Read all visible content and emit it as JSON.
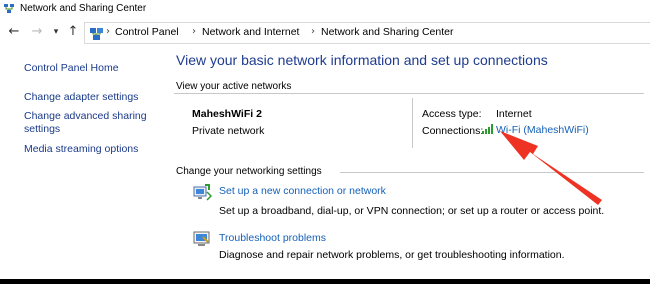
{
  "window": {
    "title": "Network and Sharing Center",
    "icon": "network-sharing-icon"
  },
  "navigation": {
    "back_icon": "back-arrow-icon",
    "forward_icon": "forward-arrow-icon",
    "recent_icon": "chevron-down-icon",
    "up_icon": "up-arrow-icon",
    "address_icon": "control-panel-icon",
    "separator": "›",
    "breadcrumbs": [
      {
        "label": "Control Panel"
      },
      {
        "label": "Network and Internet"
      },
      {
        "label": "Network and Sharing Center"
      }
    ]
  },
  "sidebar": {
    "home": "Control Panel Home",
    "links": [
      {
        "label": "Change adapter settings"
      },
      {
        "label": "Change advanced sharing settings"
      },
      {
        "label": "Media streaming options"
      }
    ]
  },
  "main": {
    "heading": "View your basic network information and set up connections",
    "active_section": "View your active networks",
    "network": {
      "name": "MaheshWiFi 2",
      "category": "Private network",
      "access_type_label": "Access type:",
      "access_type_value": "Internet",
      "connections_label": "Connections:",
      "connection_link": "Wi-Fi (MaheshWiFi)",
      "connection_icon": "wifi-signal-icon"
    },
    "change_section": "Change your networking settings",
    "tasks": [
      {
        "icon": "new-connection-icon",
        "link": "Set up a new connection or network",
        "description": "Set up a broadband, dial-up, or VPN connection; or set up a router or access point."
      },
      {
        "icon": "troubleshoot-icon",
        "link": "Troubleshoot problems",
        "description": "Diagnose and repair network problems, or get troubleshooting information."
      }
    ]
  },
  "annotation": {
    "arrow_color": "#ee3224",
    "icon": "red-callout-arrow-icon"
  }
}
